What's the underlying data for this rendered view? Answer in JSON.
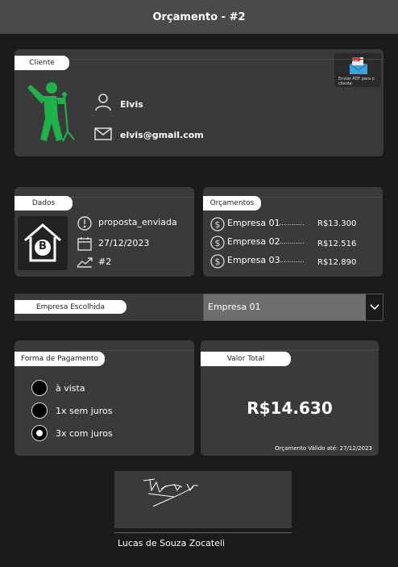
{
  "header": {
    "title": "Orçamento - #2"
  },
  "cliente": {
    "label": "Cliente",
    "name": "Elvis",
    "email": "elvis@gmail.com",
    "pdf_button_label": "Enviar PDF para o cliente",
    "pdf_badge": "PDF"
  },
  "dados": {
    "label": "Dados",
    "logo_letter": "B",
    "status": "proposta_enviada",
    "date": "27/12/2023",
    "number": "#2"
  },
  "orcamentos": {
    "label": "Orçamentos",
    "items": [
      {
        "name": "Empresa 01",
        "dots": "............",
        "value": "R$13.300"
      },
      {
        "name": "Empresa 02",
        "dots": "............",
        "value": "R$12.516"
      },
      {
        "name": "Empresa 03",
        "dots": "............",
        "value": "R$12.890"
      }
    ]
  },
  "empresa_escolhida": {
    "label": "Empresa Escolhida",
    "selected": "Empresa 01"
  },
  "pagamento": {
    "label": "Forma de Pagamento",
    "options": [
      "à vista",
      "1x sem juros",
      "3x com juros"
    ],
    "selected_index": 2
  },
  "valor_total": {
    "label": "Valor Total",
    "value": "R$14.630",
    "validity": "Orçamento Válido até: 27/12/2023"
  },
  "assinatura": {
    "name": "Lucas de Souza Zocateli"
  },
  "colors": {
    "accent_green": "#1fb24b",
    "card": "#3a3a3a",
    "background": "#1b1b1b"
  },
  "icons": [
    "singer-icon",
    "user-icon",
    "mail-icon",
    "pdf-mail-icon",
    "logo-icon",
    "alert-icon",
    "calendar-icon",
    "trend-icon",
    "dollar-icon",
    "chevron-down-icon"
  ]
}
